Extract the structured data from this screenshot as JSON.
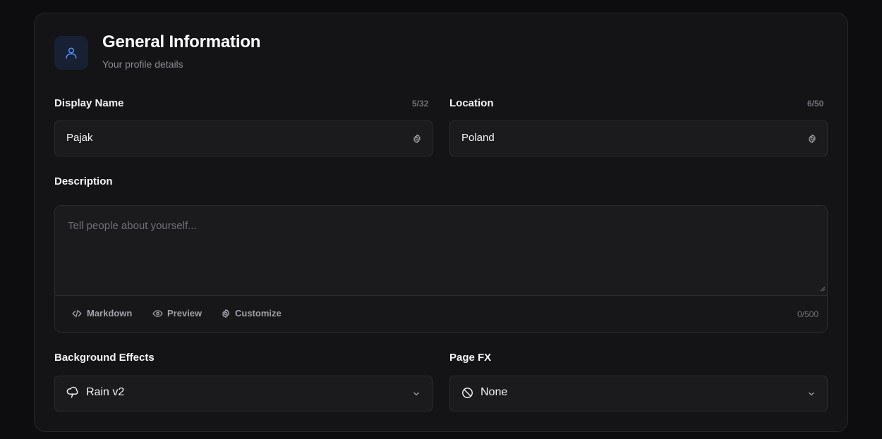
{
  "section": {
    "title": "General Information",
    "subtitle": "Your profile details",
    "icon": "user-icon"
  },
  "display_name": {
    "label": "Display Name",
    "counter": "5/32",
    "value": "Pajak"
  },
  "location": {
    "label": "Location",
    "counter": "6/50",
    "value": "Poland"
  },
  "description": {
    "label": "Description",
    "placeholder": "Tell people about yourself...",
    "value": "",
    "counter": "0/500",
    "toolbar": {
      "markdown": "Markdown",
      "preview": "Preview",
      "customize": "Customize"
    }
  },
  "background_effects": {
    "label": "Background Effects",
    "selected": "Rain v2",
    "icon": "cloud-rain-icon"
  },
  "page_fx": {
    "label": "Page FX",
    "selected": "None",
    "icon": "ban-icon"
  },
  "colors": {
    "accent": "#4f8ff7",
    "background": "#0d0d0f",
    "card": "#141416",
    "field": "#1b1b1e"
  }
}
